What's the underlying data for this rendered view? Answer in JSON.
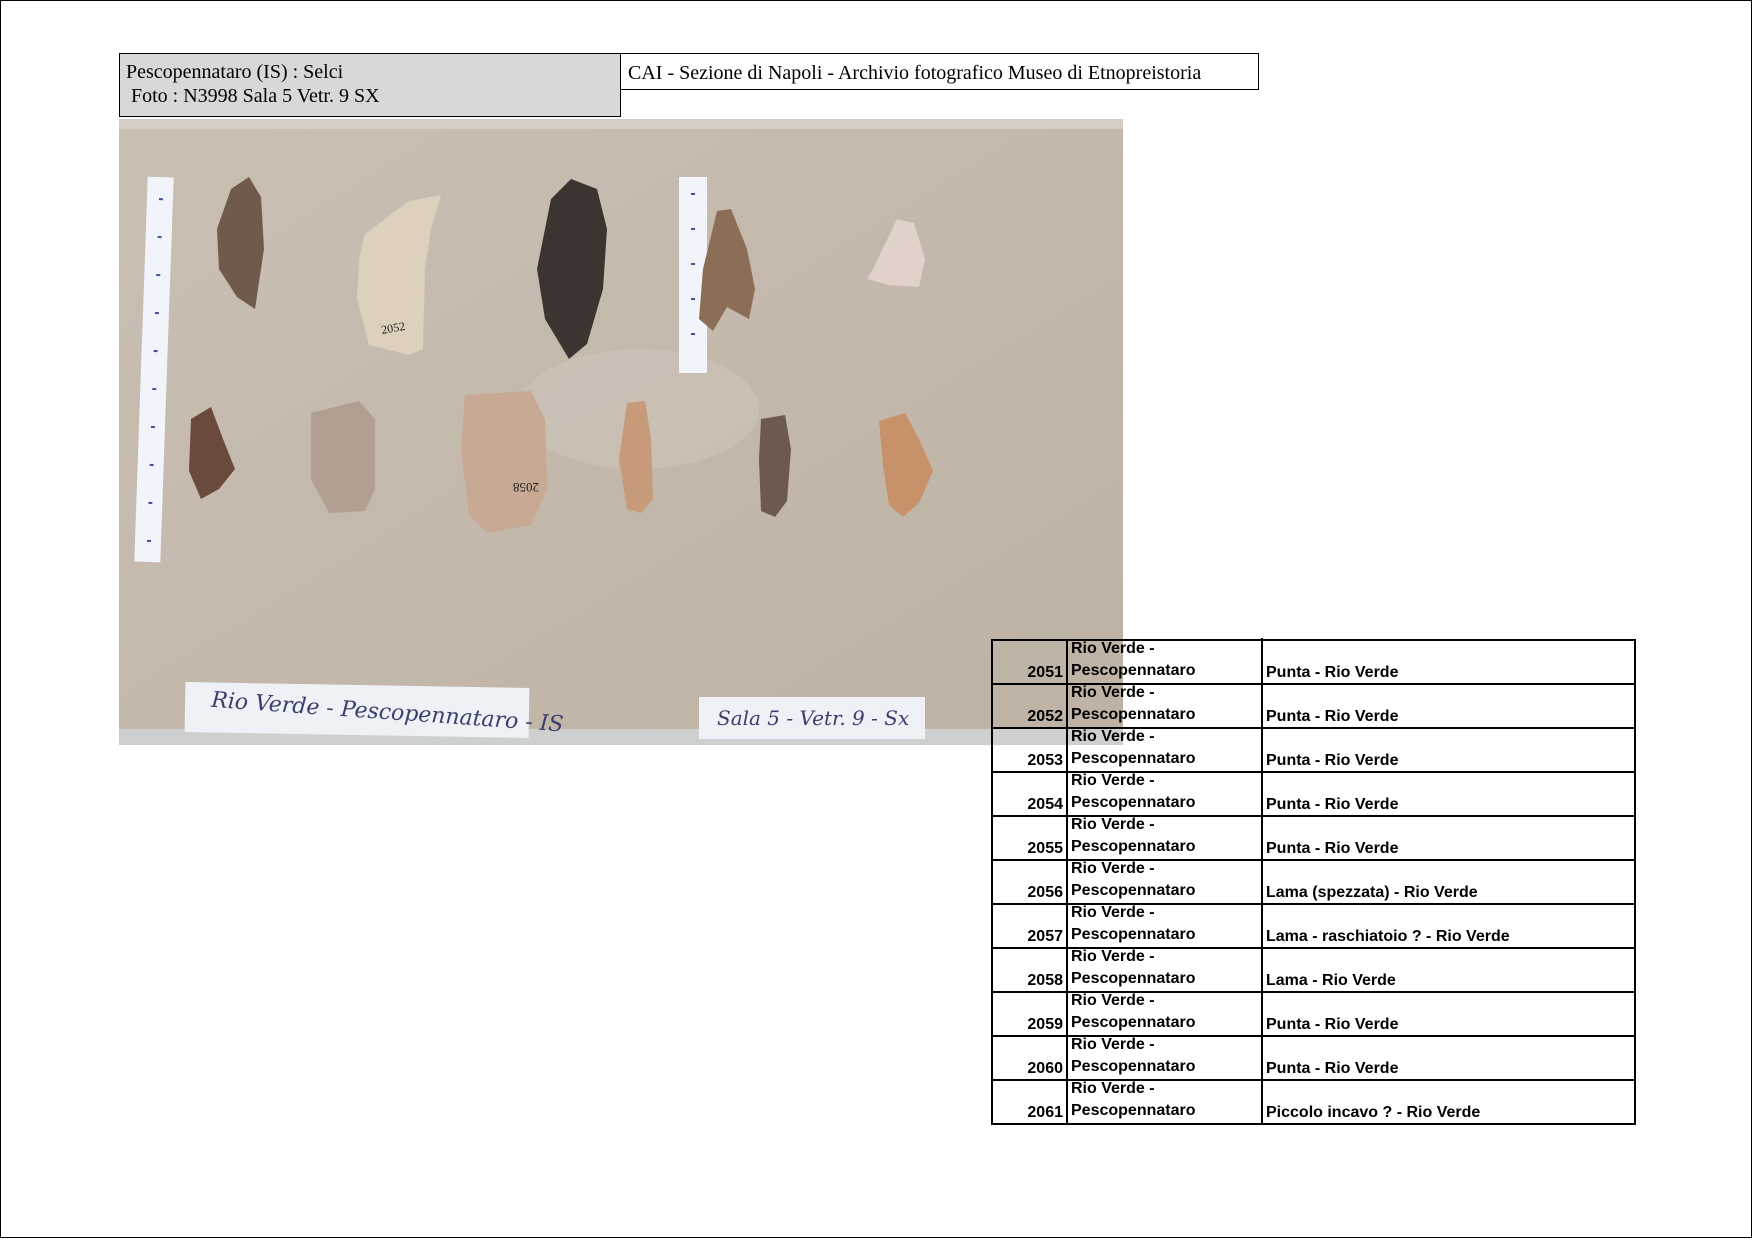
{
  "header": {
    "site": "Pescopennataro  (IS)   :  Selci",
    "photo_ref": "Foto : N3998  Sala 5  Vetr. 9 SX",
    "archive": "CAI - Sezione di Napoli  - Archivio fotografico Museo di Etnopreistoria"
  },
  "photo": {
    "label_left": "Rio Verde - Pescopennataro - IS",
    "label_right": "Sala 5 - Vetr. 9 - Sx",
    "artifact_numbers": [
      "2052",
      "2058"
    ],
    "colors": {
      "background": "#c4b9ab",
      "label_bg": "#eef1f6",
      "ink": "#3a3f6b"
    }
  },
  "table": {
    "rows": [
      {
        "num": "2051",
        "loc1": "Rio Verde -",
        "loc2": "Pescopennataro",
        "desc": "Punta  - Rio Verde"
      },
      {
        "num": "2052",
        "loc1": "Rio Verde -",
        "loc2": "Pescopennataro",
        "desc": "Punta  - Rio Verde"
      },
      {
        "num": "2053",
        "loc1": "Rio Verde -",
        "loc2": "Pescopennataro",
        "desc": "Punta  - Rio Verde"
      },
      {
        "num": "2054",
        "loc1": "Rio Verde -",
        "loc2": "Pescopennataro",
        "desc": "Punta  - Rio Verde"
      },
      {
        "num": "2055",
        "loc1": "Rio Verde -",
        "loc2": "Pescopennataro",
        "desc": "Punta  - Rio Verde"
      },
      {
        "num": "2056",
        "loc1": "Rio Verde -",
        "loc2": "Pescopennataro",
        "desc": "Lama (spezzata)  - Rio Verde"
      },
      {
        "num": "2057",
        "loc1": "Rio Verde -",
        "loc2": "Pescopennataro",
        "desc": "Lama - raschiatoio ?  - Rio Verde"
      },
      {
        "num": "2058",
        "loc1": "Rio Verde -",
        "loc2": "Pescopennataro",
        "desc": "Lama   - Rio Verde"
      },
      {
        "num": "2059",
        "loc1": "Rio Verde -",
        "loc2": "Pescopennataro",
        "desc": "Punta  - Rio Verde"
      },
      {
        "num": "2060",
        "loc1": "Rio Verde -",
        "loc2": "Pescopennataro",
        "desc": "Punta  - Rio Verde"
      },
      {
        "num": "2061",
        "loc1": "Rio Verde -",
        "loc2": "Pescopennataro",
        "desc": "Piccolo incavo ?  - Rio Verde"
      }
    ]
  }
}
